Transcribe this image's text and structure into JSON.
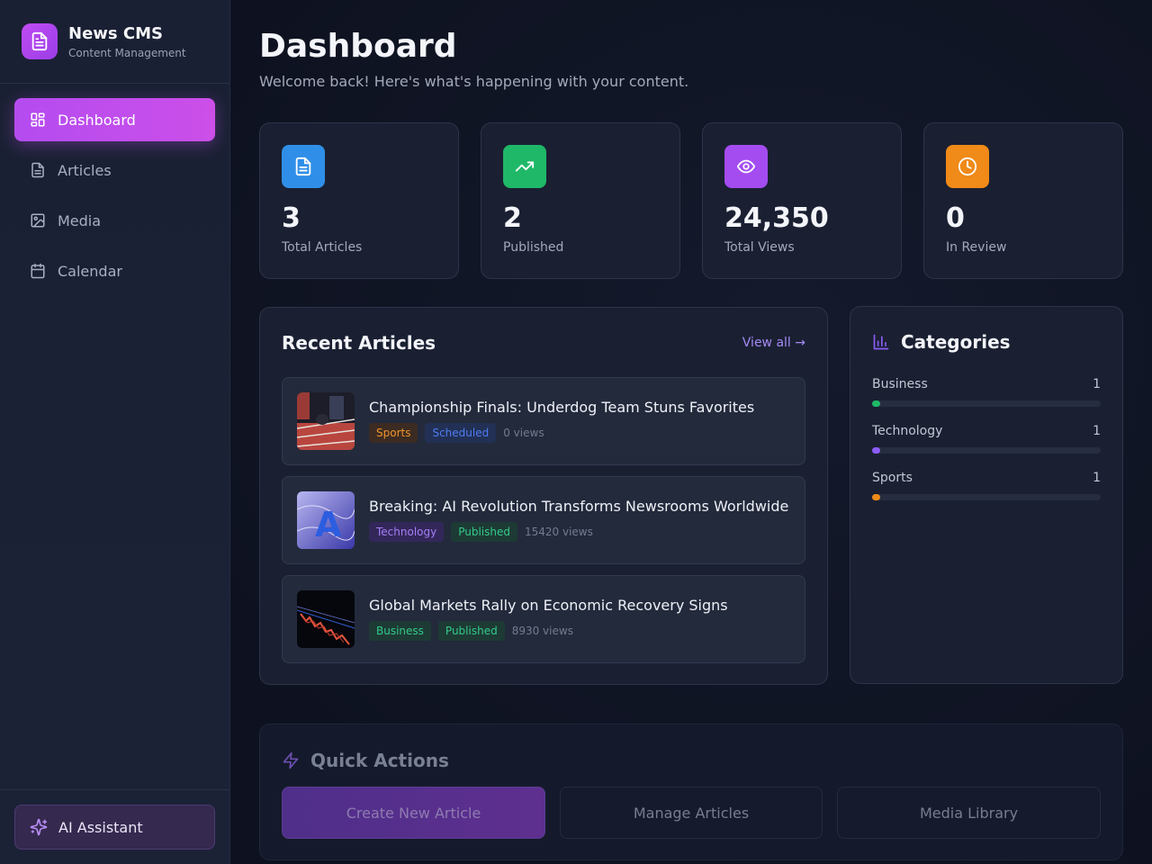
{
  "brand": {
    "title": "News CMS",
    "subtitle": "Content Management"
  },
  "nav": [
    {
      "label": "Dashboard",
      "icon": "dashboard-icon",
      "active": true
    },
    {
      "label": "Articles",
      "icon": "document-icon"
    },
    {
      "label": "Media",
      "icon": "image-icon"
    },
    {
      "label": "Calendar",
      "icon": "calendar-icon"
    }
  ],
  "ai_assistant": {
    "label": "AI Assistant",
    "icon": "sparkles-icon"
  },
  "header": {
    "title": "Dashboard",
    "subtitle": "Welcome back! Here's what's happening with your content."
  },
  "stats": [
    {
      "value": "3",
      "label": "Total Articles",
      "icon": "document-icon",
      "color": "#2f8fe8"
    },
    {
      "value": "2",
      "label": "Published",
      "icon": "trending-up-icon",
      "color": "#1fb868"
    },
    {
      "value": "24,350",
      "label": "Total Views",
      "icon": "eye-icon",
      "color": "#a44cf0"
    },
    {
      "value": "0",
      "label": "In Review",
      "icon": "clock-icon",
      "color": "#f08a18"
    }
  ],
  "recent": {
    "title": "Recent Articles",
    "view_all": "View all →",
    "articles": [
      {
        "title": "Championship Finals: Underdog Team Stuns Favorites",
        "category": "Sports",
        "status": "Scheduled",
        "views": "0 views"
      },
      {
        "title": "Breaking: AI Revolution Transforms Newsrooms Worldwide",
        "category": "Technology",
        "status": "Published",
        "views": "15420 views"
      },
      {
        "title": "Global Markets Rally on Economic Recovery Signs",
        "category": "Business",
        "status": "Published",
        "views": "8930 views"
      }
    ]
  },
  "categories": {
    "title": "Categories",
    "items": [
      {
        "name": "Business",
        "count": "1",
        "color": "#1fb868",
        "fill": 0.03
      },
      {
        "name": "Technology",
        "count": "1",
        "color": "#8b5cf6",
        "fill": 0.03
      },
      {
        "name": "Sports",
        "count": "1",
        "color": "#f08a18",
        "fill": 0.03
      }
    ]
  },
  "quick_actions": {
    "title": "Quick Actions",
    "buttons": [
      "Create New Article",
      "Manage Articles",
      "Media Library"
    ]
  }
}
